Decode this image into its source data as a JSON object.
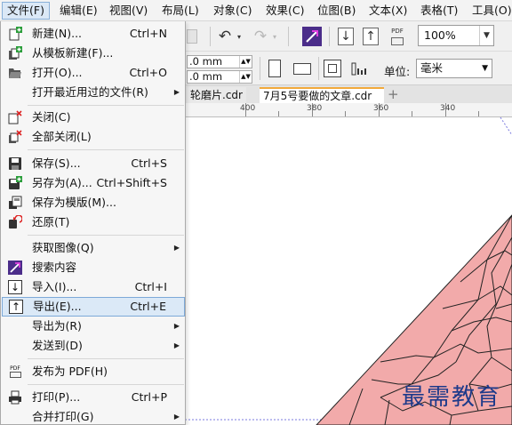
{
  "menubar": [
    {
      "label": "文件(F)",
      "active": true
    },
    {
      "label": "编辑(E)"
    },
    {
      "label": "视图(V)"
    },
    {
      "label": "布局(L)"
    },
    {
      "label": "对象(C)"
    },
    {
      "label": "效果(C)"
    },
    {
      "label": "位图(B)"
    },
    {
      "label": "文本(X)"
    },
    {
      "label": "表格(T)"
    },
    {
      "label": "工具(O)"
    }
  ],
  "toolbar": {
    "zoom_value": "100%",
    "pdf_label": "PDF",
    "size_field_1": ".0 mm",
    "size_field_2": ".0 mm",
    "unit_label": "单位:",
    "unit_value": "毫米"
  },
  "tabs": [
    {
      "label": "轮磨片.cdr"
    },
    {
      "label": "7月5号要做的文章.cdr",
      "active": true
    }
  ],
  "ruler": {
    "labels": [
      "400",
      "380",
      "360",
      "340"
    ]
  },
  "file_menu": {
    "items": [
      {
        "label": "新建(N)...",
        "shortcut": "Ctrl+N",
        "icon": "new-document-icon"
      },
      {
        "label": "从模板新建(F)...",
        "shortcut": "",
        "icon": "new-from-template-icon"
      },
      {
        "label": "打开(O)...",
        "shortcut": "Ctrl+O",
        "icon": "open-folder-icon"
      },
      {
        "label": "打开最近用过的文件(R)",
        "shortcut": "",
        "submenu": true
      },
      {
        "label": "关闭(C)",
        "shortcut": "",
        "icon": "close-document-icon"
      },
      {
        "label": "全部关闭(L)",
        "shortcut": "",
        "icon": "close-all-icon"
      },
      {
        "label": "保存(S)...",
        "shortcut": "Ctrl+S",
        "icon": "save-icon"
      },
      {
        "label": "另存为(A)...",
        "shortcut": "Ctrl+Shift+S",
        "icon": "save-as-icon"
      },
      {
        "label": "保存为模版(M)...",
        "shortcut": "",
        "icon": "save-template-icon"
      },
      {
        "label": "还原(T)",
        "shortcut": "",
        "icon": "revert-icon"
      },
      {
        "label": "获取图像(Q)",
        "shortcut": "",
        "submenu": true
      },
      {
        "label": "搜索内容",
        "shortcut": "",
        "icon": "search-content-icon"
      },
      {
        "label": "导入(I)...",
        "shortcut": "Ctrl+I",
        "icon": "import-icon"
      },
      {
        "label": "导出(E)...",
        "shortcut": "Ctrl+E",
        "icon": "export-icon",
        "highlighted": true
      },
      {
        "label": "导出为(R)",
        "shortcut": "",
        "submenu": true
      },
      {
        "label": "发送到(D)",
        "shortcut": "",
        "submenu": true
      },
      {
        "label": "发布为 PDF(H)",
        "shortcut": "",
        "icon": "publish-pdf-icon"
      },
      {
        "label": "打印(P)...",
        "shortcut": "Ctrl+P",
        "icon": "print-icon"
      },
      {
        "label": "合并打印(G)",
        "shortcut": "",
        "submenu": true
      }
    ]
  },
  "icon_text": {
    "pdf": "PDF"
  },
  "watermark": "最需教育",
  "colors": {
    "accent": "#7da9d8",
    "shape_fill": "#f2aaaa",
    "shape_stroke": "#222222",
    "tab_accent": "#f2a93b"
  }
}
